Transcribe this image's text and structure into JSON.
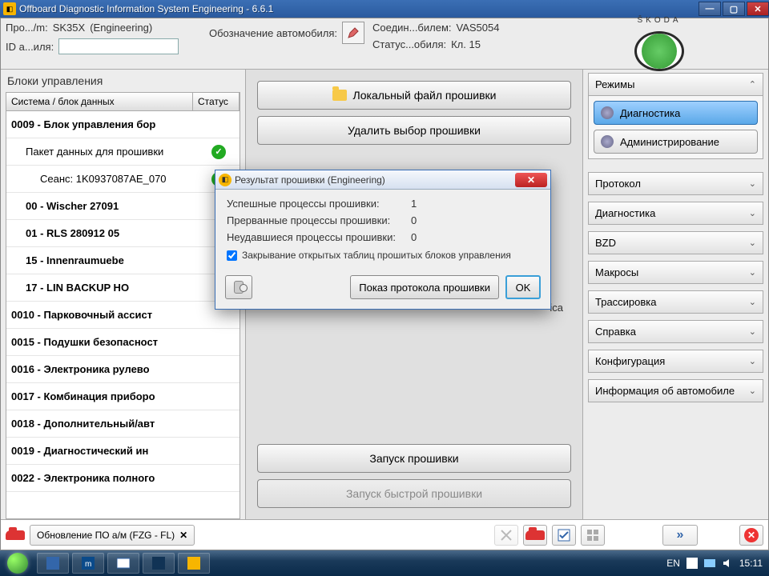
{
  "window": {
    "title": "Offboard Diagnostic Information System Engineering - 6.6.1"
  },
  "header": {
    "program_label": "Про.../m:",
    "program_val": "SK35X",
    "program_sub": "(Engineering)",
    "id_label": "ID а...иля:",
    "id_val": "",
    "vehicle_label": "Обозначение автомобиля:",
    "connect_label": "Соедин...билем:",
    "connect_val": "VAS5054",
    "status_label": "Статус...обиля:",
    "status_val": "Кл. 15"
  },
  "brand": {
    "name": "ŠKODA"
  },
  "left": {
    "title": "Блоки управления",
    "col_system": "Система / блок данных",
    "col_status": "Статус",
    "rows": [
      {
        "text": "0009 - Блок управления бор",
        "bold": true
      },
      {
        "text": "Пакет данных для прошивки",
        "indent": 1,
        "ok": true
      },
      {
        "text": "Сеанс: 1K0937087AE_070",
        "indent": 2,
        "ok": true
      },
      {
        "text": "00 - Wischer 27091",
        "bold": true,
        "indent": 1
      },
      {
        "text": "01 - RLS 280912 05",
        "bold": true,
        "indent": 1
      },
      {
        "text": "15 - Innenraumuebe",
        "bold": true,
        "indent": 1
      },
      {
        "text": "17 - LIN BACKUP HO",
        "bold": true,
        "indent": 1
      },
      {
        "text": "0010 - Парковочный ассист",
        "bold": true
      },
      {
        "text": "0015 - Подушки безопасност",
        "bold": true
      },
      {
        "text": "0016 - Электроника рулево",
        "bold": true
      },
      {
        "text": "0017 - Комбинация приборо",
        "bold": true
      },
      {
        "text": "0018 - Дополнительный/авт",
        "bold": true
      },
      {
        "text": "0019 - Диагностический ин",
        "bold": true
      },
      {
        "text": "0022 - Электроника полного",
        "bold": true
      }
    ]
  },
  "center": {
    "btn_local": "Локальный файл прошивки",
    "btn_delete": "Удалить выбор прошивки",
    "hidden_suffix": "ica",
    "btn_start": "Запуск прошивки",
    "btn_fast": "Запуск быстрой прошивки"
  },
  "right": {
    "modes_title": "Режимы",
    "diag": "Диагностика",
    "admin": "Администрирование",
    "panels": [
      "Протокол",
      "Диагностика",
      "BZD",
      "Макросы",
      "Трассировка",
      "Справка",
      "Конфигурация",
      "Информация об автомобиле"
    ]
  },
  "bottom": {
    "chip": "Обновление ПО а/м (FZG - FL)"
  },
  "dialog": {
    "title": "Результат прошивки (Engineering)",
    "k1": "Успешные процессы прошивки:",
    "v1": "1",
    "k2": "Прерванные процессы прошивки:",
    "v2": "0",
    "k3": "Неудавшиеся процессы прошивки:",
    "v3": "0",
    "check_label": "Закрывание открытых таблиц прошитых блоков управления",
    "protocol_btn": "Показ протокола прошивки",
    "ok_btn": "OK"
  },
  "taskbar": {
    "lang": "EN",
    "time": "15:11"
  }
}
